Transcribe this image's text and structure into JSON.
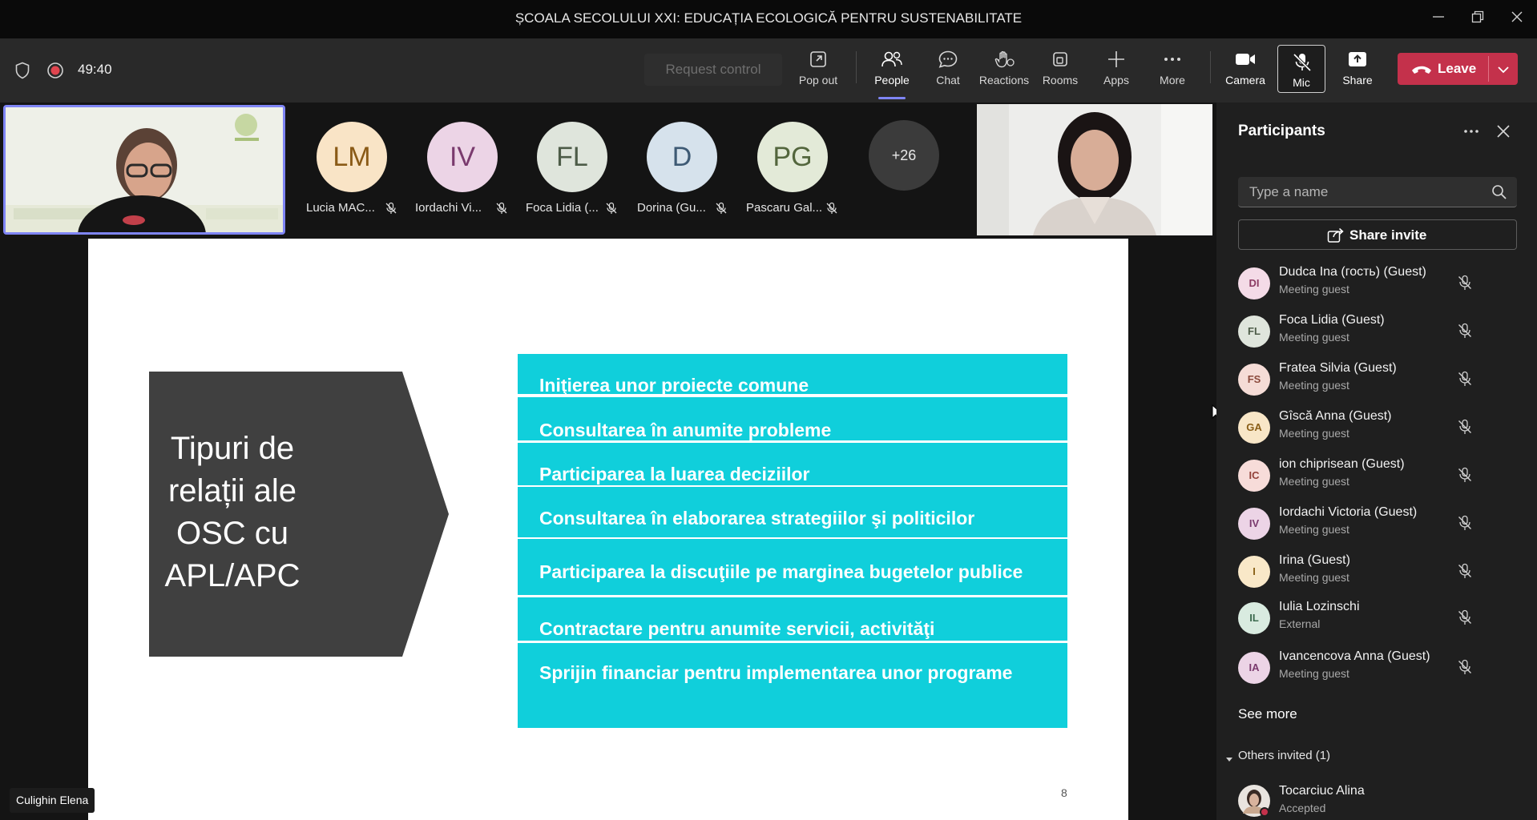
{
  "window": {
    "title": "ȘCOALA SECOLULUI XXI: EDUCAȚIA ECOLOGICĂ PENTRU SUSTENABILITATE"
  },
  "toolbar": {
    "timer": "49:40",
    "request_control": "Request control",
    "pop_out": "Pop out",
    "people": "People",
    "chat": "Chat",
    "reactions": "Reactions",
    "rooms": "Rooms",
    "apps": "Apps",
    "more": "More",
    "camera": "Camera",
    "mic": "Mic",
    "share": "Share",
    "leave": "Leave"
  },
  "gallery": {
    "tiles": [
      {
        "initials": "LM",
        "name": "Lucia MAC...",
        "bg": "#f9e4c6",
        "fg": "#8a5a16"
      },
      {
        "initials": "IV",
        "name": "Iordachi Vi...",
        "bg": "#ecd4e6",
        "fg": "#7a3a6e"
      },
      {
        "initials": "FL",
        "name": "Foca Lidia (...",
        "bg": "#dfe5dc",
        "fg": "#4d5c48"
      },
      {
        "initials": "D",
        "name": "Dorina (Gu...",
        "bg": "#d6e2ec",
        "fg": "#3e5a74"
      },
      {
        "initials": "PG",
        "name": "Pascaru Gal...",
        "bg": "#e3ead8",
        "fg": "#53663d"
      }
    ],
    "overflow": "+26"
  },
  "slide": {
    "title": "Tipuri de relații ale OSC cu APL/APC",
    "items": [
      "Iniţierea unor proiecte comune",
      "Consultarea în anumite probleme",
      "Participarea la luarea deciziilor",
      "Consultarea în elaborarea strategiilor şi politicilor",
      "Participarea la discuţiile pe marginea bugetelor publice",
      "Contractare pentru anumite servicii, activităţi",
      "Sprijin financiar pentru implementarea unor programe"
    ],
    "page_number": "8",
    "accent_color": "#10cfdb",
    "chevron_color": "#404040"
  },
  "presenter": {
    "name": "Culighin Elena"
  },
  "panel": {
    "title": "Participants",
    "search_placeholder": "Type a name",
    "share_invite": "Share invite",
    "participants": [
      {
        "initials": "DI",
        "name": "Dudca Ina (гость) (Guest)",
        "status": "Meeting guest",
        "bg": "#f4dbe7",
        "fg": "#8c3b63"
      },
      {
        "initials": "FL",
        "name": "Foca Lidia (Guest)",
        "status": "Meeting guest",
        "bg": "#dfe5dc",
        "fg": "#4d5c48"
      },
      {
        "initials": "FS",
        "name": "Fratea Silvia (Guest)",
        "status": "Meeting guest",
        "bg": "#f5dcd6",
        "fg": "#8b4a3c"
      },
      {
        "initials": "GA",
        "name": "Gîscă Anna (Guest)",
        "status": "Meeting guest",
        "bg": "#f8e6c7",
        "fg": "#8a5e17"
      },
      {
        "initials": "IC",
        "name": "ion chiprisean (Guest)",
        "status": "Meeting guest",
        "bg": "#f7dcd9",
        "fg": "#93423a"
      },
      {
        "initials": "IV",
        "name": "Iordachi Victoria (Guest)",
        "status": "Meeting guest",
        "bg": "#ecd4e6",
        "fg": "#7a3a6e"
      },
      {
        "initials": "I",
        "name": "Irina (Guest)",
        "status": "Meeting guest",
        "bg": "#f9e8c8",
        "fg": "#8a6218"
      },
      {
        "initials": "IL",
        "name": "Iulia Lozinschi",
        "status": "External",
        "bg": "#d9ebe0",
        "fg": "#3d6b4f"
      },
      {
        "initials": "IA",
        "name": "Ivancencova Anna (Guest)",
        "status": "Meeting guest",
        "bg": "#ecd4e6",
        "fg": "#7a3a6e"
      }
    ],
    "see_more": "See more",
    "others_invited": "Others invited (1)",
    "invited": [
      {
        "name": "Tocarciuc Alina",
        "status": "Accepted"
      }
    ]
  }
}
